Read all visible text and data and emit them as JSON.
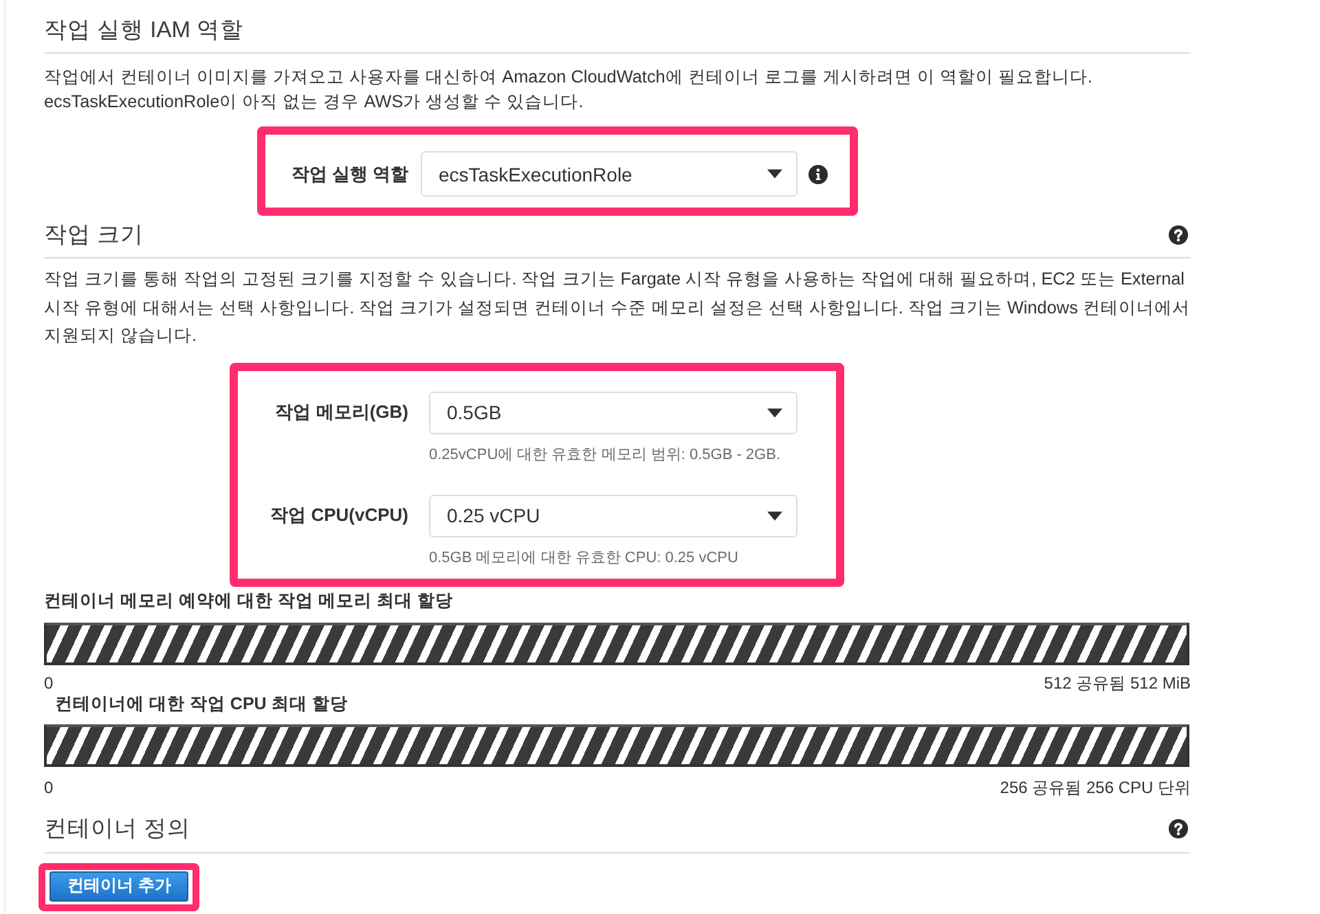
{
  "iam_role_section": {
    "title": "작업 실행 IAM 역할",
    "description": [
      "작업에서 컨테이너 이미지를 가져오고 사용자를 대신하여 Amazon CloudWatch에 컨테이너 로그를 게시하려면 이 역할이 필요합니다.",
      "ecsTaskExecutionRole이 아직 없는 경우 AWS가 생성할 수 있습니다."
    ],
    "highlighted": true,
    "field": {
      "label": "작업 실행 역할",
      "value": "ecsTaskExecutionRole"
    }
  },
  "task_size_section": {
    "title": "작업 크기",
    "description": "작업 크기를 통해 작업의 고정된 크기를 지정할 수 있습니다. 작업 크기는 Fargate 시작 유형을 사용하는 작업에 대해 필요하며, EC2 또는 External 시작 유형에 대해서는 선택 사항입니다. 작업 크기가 설정되면 컨테이너 수준 메모리 설정은 선택 사항입니다. 작업 크기는 Windows 컨테이너에서 지원되지 않습니다.",
    "highlighted": true,
    "fields": [
      {
        "label": "작업 메모리(GB)",
        "value": "0.5GB",
        "hint": "0.25vCPU에 대한 유효한 메모리 범위: 0.5GB - 2GB."
      },
      {
        "label": "작업 CPU(vCPU)",
        "value": "0.25 vCPU",
        "hint": "0.5GB 메모리에 대한 유효한 CPU: 0.25 vCPU"
      }
    ],
    "allocations": [
      {
        "title": "컨테이너 메모리 예약에 대한 작업 메모리 최대 할당",
        "min": "0",
        "max": "512 공유됨 512 MiB"
      },
      {
        "title": "컨테이너에 대한 작업 CPU 최대 할당",
        "min": "0",
        "max": "256 공유됨 256 CPU 단위"
      }
    ]
  },
  "container_definitions_section": {
    "title": "컨테이너 정의",
    "add_button": {
      "label": "컨테이너 추가",
      "highlighted": true
    }
  }
}
